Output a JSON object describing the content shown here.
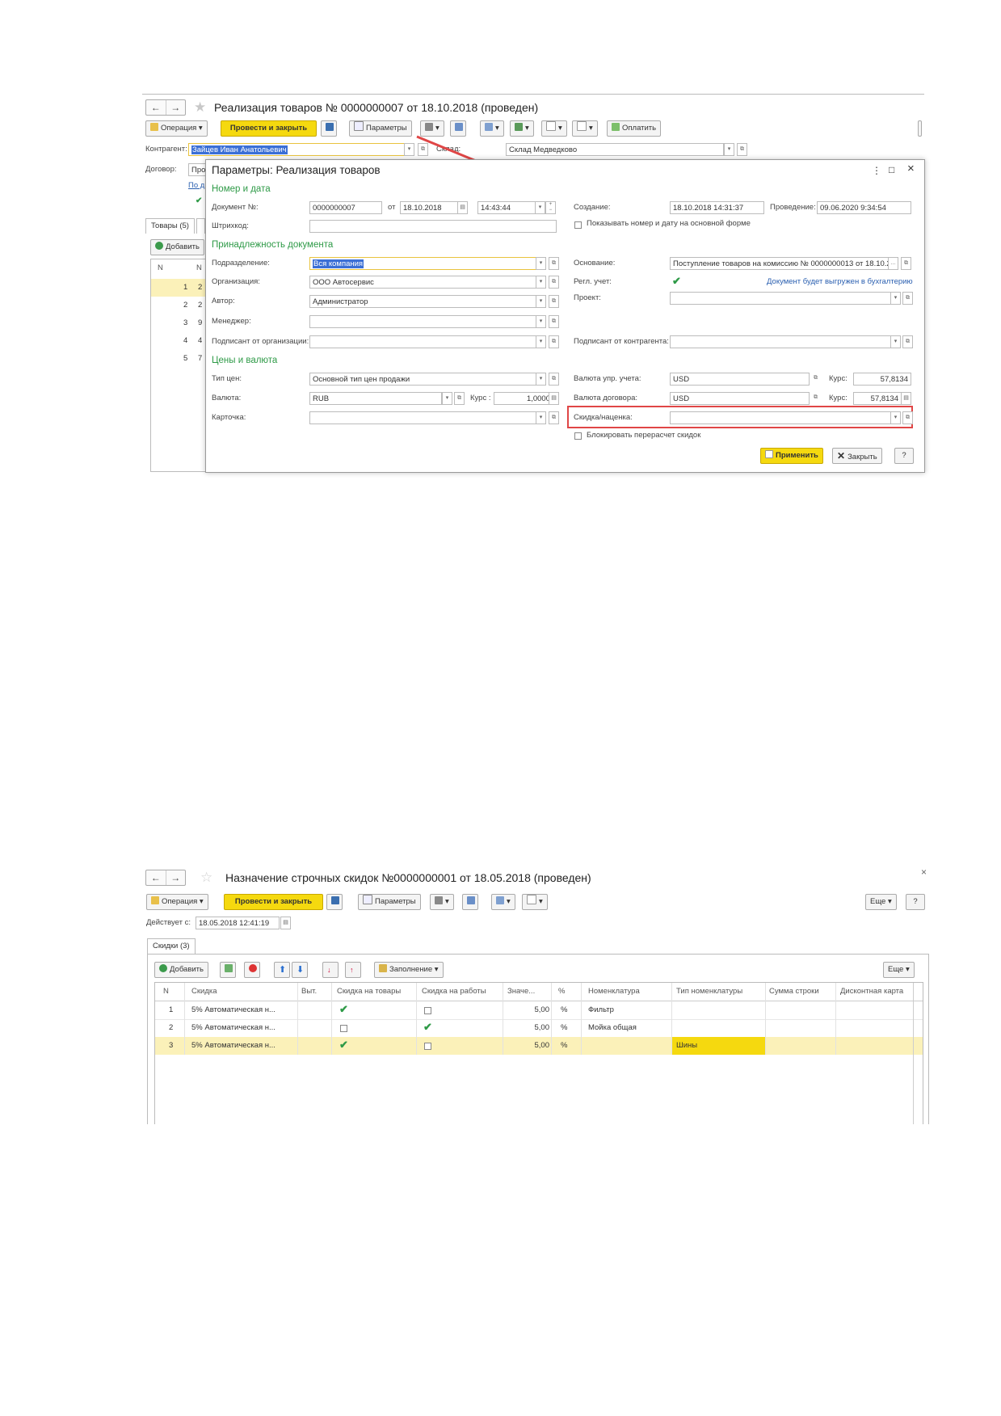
{
  "screen1": {
    "title": "Реализация товаров № 0000000007  от 18.10.2018 (проведен)",
    "toolbar": {
      "operation": "Операция",
      "post_close": "Провести и закрыть",
      "params": "Параметры",
      "pay": "Оплатить"
    },
    "form": {
      "contractor_label": "Контрагент:",
      "contractor_value": "Зайцев Иван Анатольевич",
      "warehouse_label": "Склад:",
      "warehouse_value": "Склад Медведково",
      "contract_label": "Договор:",
      "contract_value": "Про",
      "link_value": "По д"
    },
    "tabs": {
      "goods": "Товары (5)",
      "add": "Добавить"
    },
    "grid": {
      "col_n": "N",
      "col_no": "N",
      "rows": [
        {
          "n": "1",
          "v": "2"
        },
        {
          "n": "2",
          "v": "2"
        },
        {
          "n": "3",
          "v": "9"
        },
        {
          "n": "4",
          "v": "4"
        },
        {
          "n": "5",
          "v": "7"
        }
      ]
    }
  },
  "dialog": {
    "title": "Параметры: Реализация товаров",
    "controls": {
      "more": "⋮",
      "maximize": "□",
      "close": "×"
    },
    "section_number": "Номер и дата",
    "doc_no_label": "Документ №:",
    "doc_no_value": "0000000007",
    "from_label": "от",
    "date_value": "18.10.2018",
    "time_value": "14:43:44",
    "created_label": "Создание:",
    "created_value": "18.10.2018 14:31:37",
    "posted_label": "Проведение:",
    "posted_value": "09.06.2020  9:34:54",
    "barcode_label": "Штрихкод:",
    "show_number_label": "Показывать номер и дату на основной форме",
    "section_belong": "Принадлежность документа",
    "dept_label": "Подразделение:",
    "dept_value": "Вся компания",
    "basis_label": "Основание:",
    "basis_value": "Поступление товаров на комиссию № 0000000013  от 18.10.2",
    "org_label": "Организация:",
    "org_value": "ООО Автосервис",
    "regl_label": "Регл. учет:",
    "regl_note": "Документ будет выгружен в бухгалтерию",
    "author_label": "Автор:",
    "author_value": "Администратор",
    "project_label": "Проект:",
    "manager_label": "Менеджер:",
    "signer_org_label": "Подписант от организации:",
    "signer_contr_label": "Подписант от контрагента:",
    "section_prices": "Цены и валюта",
    "price_type_label": "Тип цен:",
    "price_type_value": "Основной тип цен продажи",
    "mgmt_currency_label": "Валюта упр. учета:",
    "mgmt_currency_value": "USD",
    "rate_label": "Курс:",
    "mgmt_rate_value": "57,8134",
    "currency_label": "Валюта:",
    "currency_value": "RUB",
    "rate_label2": "Курс :",
    "currency_rate_value": "1,0000",
    "contract_currency_label": "Валюта договора:",
    "contract_currency_value": "USD",
    "contract_rate_value": "57,8134",
    "card_label": "Карточка:",
    "discount_label": "Скидка/наценка:",
    "block_recalc_label": "Блокировать перерасчет скидок",
    "apply_button": "Применить",
    "close_button": "Закрыть",
    "help_button": "?"
  },
  "screen2": {
    "title": "Назначение строчных скидок №0000000001 от 18.05.2018 (проведен)",
    "toolbar": {
      "operation": "Операция",
      "post_close": "Провести и закрыть",
      "params": "Параметры",
      "more": "Еще",
      "help": "?"
    },
    "valid_from_label": "Действует с:",
    "valid_from_value": "18.05.2018 12:41:19",
    "tab": "Скидки (3)",
    "sub_toolbar": {
      "add": "Добавить",
      "fill": "Заполнение",
      "more": "Еще"
    },
    "close_x": "×",
    "columns": [
      "N",
      "Скидка",
      "Выт.",
      "Скидка на товары",
      "Скидка на работы",
      "Значе...",
      "%",
      "Номенклатура",
      "Тип номенклатуры",
      "Сумма строки",
      "Дисконтная карта"
    ],
    "rows": [
      {
        "n": "1",
        "discount": "5% Автоматическая н...",
        "goods": true,
        "works": false,
        "value": "5,00",
        "pct": "%",
        "item": "Фильтр",
        "type": ""
      },
      {
        "n": "2",
        "discount": "5% Автоматическая н...",
        "goods": false,
        "works": true,
        "value": "5,00",
        "pct": "%",
        "item": "Мойка общая",
        "type": ""
      },
      {
        "n": "3",
        "discount": "5% Автоматическая н...",
        "goods": true,
        "works": false,
        "value": "5,00",
        "pct": "%",
        "item": "",
        "type": "Шины"
      }
    ]
  },
  "colors": {
    "accent_yellow": "#f5d90f",
    "section_green": "#2e9a47",
    "highlight_red": "#e04646",
    "row_selected": "#fbf1b9"
  },
  "icons": [
    "back-arrow-icon",
    "forward-arrow-icon",
    "star-icon",
    "save-icon",
    "print-icon",
    "calendar-icon",
    "open-link-icon",
    "check-icon",
    "add-icon",
    "delete-icon",
    "arrow-up-icon",
    "arrow-down-icon",
    "sort-icon"
  ]
}
